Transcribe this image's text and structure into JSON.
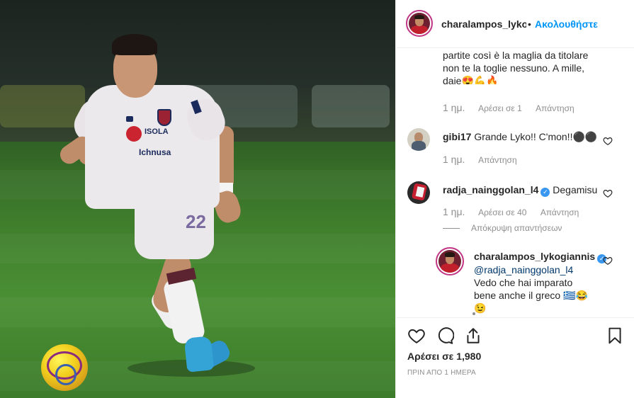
{
  "header": {
    "username": "charalampos_lykoς",
    "separator": "•",
    "follow_label": "Ακολουθήστε"
  },
  "comments": [
    {
      "text_partial": "partite così è la maglia da titolare non te la toglie nessuno. A mille, daje😍💪🔥",
      "time": "1 ημ.",
      "likes": "Αρέσει σε 1",
      "reply_label": "Απάντηση"
    },
    {
      "username": "gibi17",
      "text": "Grande Lyko!! C'mon!!⚫⚫",
      "time": "1 ημ.",
      "reply_label": "Απάντηση"
    },
    {
      "username": "radja_nainggolan_l4",
      "text": "Degamisu",
      "time": "1 ημ.",
      "likes": "Αρέσει σε 40",
      "reply_label": "Απάντηση",
      "hide_replies_label": "Απόκρυψη απαντήσεων",
      "reply": {
        "username": "charalampos_lykogiannis",
        "mention": "@radja_nainggolan_l4",
        "text": "Vedo che hai imparato bene anche il greco 🇬🇷😂😉"
      }
    }
  ],
  "post": {
    "likes_label": "Αρέσει σε 1,980",
    "timestamp": "ΠΡΙΝ ΑΠΟ 1 ΗΜΕΡΑ"
  },
  "photo": {
    "shirt_number": "22",
    "sponsor_1": "ISOLA",
    "sponsor_2": "Ichnusa"
  },
  "colors": {
    "link_blue": "#0095f6",
    "verified_blue": "#3897f0",
    "secondary_text": "#8e8e8e",
    "story_ring": "#c13584"
  }
}
